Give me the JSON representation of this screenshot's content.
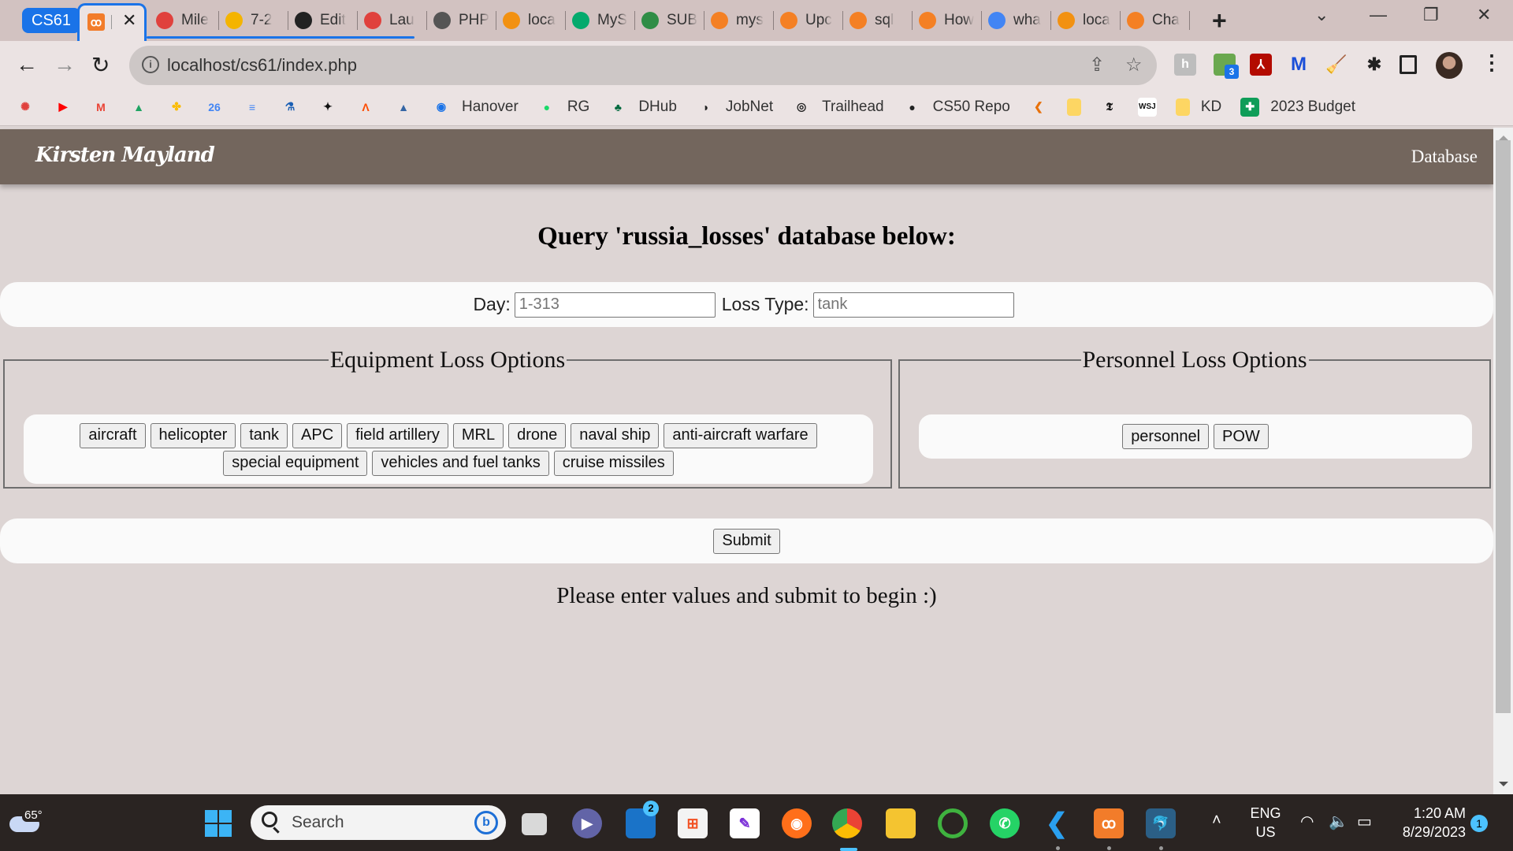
{
  "browser": {
    "tab_group_label": "CS61",
    "active_tab": {
      "favicon": "xampp-icon",
      "close_glyph": "✕"
    },
    "tabs": [
      {
        "label": "Mile",
        "icon": "canvas-icon",
        "color": "#e0413d"
      },
      {
        "label": "7-2",
        "icon": "slides-icon",
        "color": "#f4b400"
      },
      {
        "label": "Edit",
        "icon": "github-icon",
        "color": "#222222"
      },
      {
        "label": "Lau",
        "icon": "canvas-icon",
        "color": "#e0413d"
      },
      {
        "label": "PHP",
        "icon": "globe-icon",
        "color": "#555555"
      },
      {
        "label": "loca",
        "icon": "phpmyadmin-icon",
        "color": "#f29111"
      },
      {
        "label": "MyS",
        "icon": "w3schools-icon",
        "color": "#04aa6d"
      },
      {
        "label": "SUB",
        "icon": "geeksforgeeks-icon",
        "color": "#2f8d46"
      },
      {
        "label": "mys",
        "icon": "stackoverflow-icon",
        "color": "#f48024"
      },
      {
        "label": "Upc",
        "icon": "stackoverflow-icon",
        "color": "#f48024"
      },
      {
        "label": "sql",
        "icon": "stackoverflow-icon",
        "color": "#f48024"
      },
      {
        "label": "How",
        "icon": "stackoverflow-icon",
        "color": "#f48024"
      },
      {
        "label": "wha",
        "icon": "google-icon",
        "color": "#4285f4"
      },
      {
        "label": "loca",
        "icon": "phpmyadmin-icon",
        "color": "#f29111"
      },
      {
        "label": "Cha",
        "icon": "stackoverflow-icon",
        "color": "#f48024"
      }
    ],
    "new_tab_glyph": "+",
    "url": "localhost/cs61/index.php",
    "extension_badge": "3",
    "bookmarks": [
      {
        "label": "",
        "icon": "canvas-icon",
        "color": "#e0413d",
        "glyph": "✺"
      },
      {
        "label": "",
        "icon": "youtube-icon",
        "color": "#ff0000",
        "glyph": "▶"
      },
      {
        "label": "",
        "icon": "gmail-icon",
        "color": "#ea4335",
        "glyph": "M"
      },
      {
        "label": "",
        "icon": "google-drive-icon",
        "color": "#1fa463",
        "glyph": "▲"
      },
      {
        "label": "",
        "icon": "google-photos-icon",
        "color": "#fbbc04",
        "glyph": "✤"
      },
      {
        "label": "",
        "icon": "google-calendar-icon",
        "color": "#4285f4",
        "glyph": "26"
      },
      {
        "label": "",
        "icon": "google-docs-icon",
        "color": "#4285f4",
        "glyph": "≡"
      },
      {
        "label": "",
        "icon": "pharmacy-icon",
        "color": "#1a5fb4",
        "glyph": "⚗"
      },
      {
        "label": "",
        "icon": "runner-icon",
        "color": "#111111",
        "glyph": "✦"
      },
      {
        "label": "",
        "icon": "strava-icon",
        "color": "#fc4c02",
        "glyph": "Λ"
      },
      {
        "label": "",
        "icon": "triangle-icon",
        "color": "#3465a4",
        "glyph": "▲"
      },
      {
        "label": "Hanover",
        "icon": "noaa-icon",
        "color": "#1a73e8",
        "glyph": "◉"
      },
      {
        "label": "RG",
        "icon": "green-dot-icon",
        "color": "#1bd96a",
        "glyph": "●"
      },
      {
        "label": "DHub",
        "icon": "dartmouth-icon",
        "color": "#00693e",
        "glyph": "♣"
      },
      {
        "label": "JobNet",
        "icon": "jobnet-icon",
        "color": "#222222",
        "glyph": "◑"
      },
      {
        "label": "Trailhead",
        "icon": "trailhead-icon",
        "color": "#222222",
        "glyph": "◎"
      },
      {
        "label": "CS50 Repo",
        "icon": "github-icon",
        "color": "#222222",
        "glyph": "●"
      },
      {
        "label": "",
        "icon": "colorful-bracket-icon",
        "color": "#e8710a",
        "glyph": "❮"
      },
      {
        "label": "",
        "icon": "folder-icon",
        "color": "#fdd663",
        "glyph": ""
      },
      {
        "label": "",
        "icon": "nytimes-icon",
        "color": "#111111",
        "glyph": "𝕿"
      },
      {
        "label": "",
        "icon": "wsj-icon",
        "color": "#111111",
        "glyph": "WSJ"
      },
      {
        "label": "KD",
        "icon": "folder-icon",
        "color": "#fdd663",
        "glyph": ""
      },
      {
        "label": "2023 Budget",
        "icon": "google-sheets-icon",
        "color": "#0f9d58",
        "glyph": "✚"
      }
    ]
  },
  "site": {
    "brand": "Kirsten Mayland",
    "nav_link": "Database",
    "title": "Query 'russia_losses' database below:",
    "form": {
      "day_label": "Day:",
      "day_placeholder": "1-313",
      "day_value": "",
      "loss_type_label": "Loss Type:",
      "loss_type_placeholder": "tank",
      "loss_type_value": ""
    },
    "equipment": {
      "legend": "Equipment Loss Options",
      "options": [
        "aircraft",
        "helicopter",
        "tank",
        "APC",
        "field artillery",
        "MRL",
        "drone",
        "naval ship",
        "anti-aircraft warfare",
        "special equipment",
        "vehicles and fuel tanks",
        "cruise missiles"
      ]
    },
    "personnel": {
      "legend": "Personnel Loss Options",
      "options": [
        "personnel",
        "POW"
      ]
    },
    "submit_label": "Submit",
    "message": "Please enter values and submit to begin :)"
  },
  "taskbar": {
    "weather_temp": "65°",
    "search_placeholder": "Search",
    "teams_badge": "2",
    "language_line1": "ENG",
    "language_line2": "US",
    "time": "1:20 AM",
    "date": "8/29/2023",
    "notification_count": "1"
  }
}
